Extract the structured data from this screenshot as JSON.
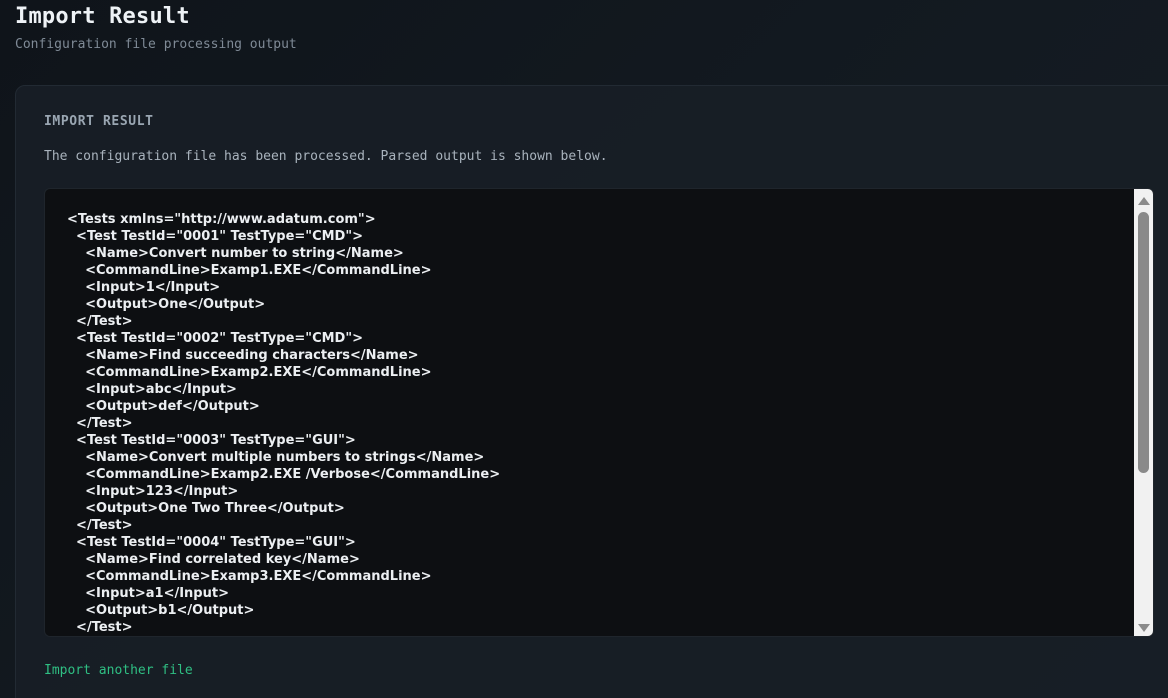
{
  "header": {
    "title": "Import Result",
    "subtitle": "Configuration file processing output"
  },
  "card": {
    "heading": "IMPORT RESULT",
    "description": "The configuration file has been processed. Parsed output is shown below.",
    "output": "<Tests xmlns=\"http://www.adatum.com\">\n  <Test TestId=\"0001\" TestType=\"CMD\">\n    <Name>Convert number to string</Name>\n    <CommandLine>Examp1.EXE</CommandLine>\n    <Input>1</Input>\n    <Output>One</Output>\n  </Test>\n  <Test TestId=\"0002\" TestType=\"CMD\">\n    <Name>Find succeeding characters</Name>\n    <CommandLine>Examp2.EXE</CommandLine>\n    <Input>abc</Input>\n    <Output>def</Output>\n  </Test>\n  <Test TestId=\"0003\" TestType=\"GUI\">\n    <Name>Convert multiple numbers to strings</Name>\n    <CommandLine>Examp2.EXE /Verbose</CommandLine>\n    <Input>123</Input>\n    <Output>One Two Three</Output>\n  </Test>\n  <Test TestId=\"0004\" TestType=\"GUI\">\n    <Name>Find correlated key</Name>\n    <CommandLine>Examp3.EXE</CommandLine>\n    <Input>a1</Input>\n    <Output>b1</Output>\n  </Test>",
    "link_label": "Import another file"
  },
  "scrollbar": {
    "up_icon": "triangle-up",
    "down_icon": "triangle-down"
  },
  "colors": {
    "accent": "#2fbf83",
    "background": "#0e1217",
    "output_bg": "#0d0f12"
  }
}
